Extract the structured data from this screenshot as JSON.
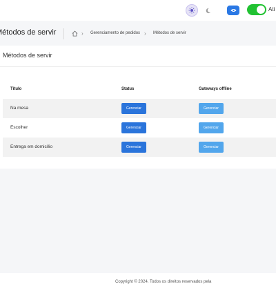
{
  "topbar": {
    "toggle_label": "Ati",
    "colors": {
      "toggle": "#21c232",
      "eye": "#2a78e4",
      "theme_active": "#e6e3f6"
    },
    "icons": [
      "sun-icon",
      "moon-icon",
      "eye-icon"
    ]
  },
  "header": {
    "title": "Métodos de servir",
    "breadcrumb": [
      "Gerenciamento de pedidos",
      "Métodos de servir"
    ]
  },
  "card": {
    "title": "Métodos de servir",
    "columns": [
      "Título",
      "Status",
      "Gateways offline"
    ],
    "rows": [
      {
        "label": "Na mesa",
        "status_button": "Gerenciar",
        "gateway_button": "Gerenciar"
      },
      {
        "label": "Escolher",
        "status_button": "Gerenciar",
        "gateway_button": "Gerenciar"
      },
      {
        "label": "Entrega em domicílio",
        "status_button": "Gerenciar",
        "gateway_button": "Gerenciar"
      }
    ],
    "colors": {
      "primary_button": "#2a74db",
      "secondary_button": "#52a6ec"
    }
  },
  "footer": {
    "text": "Copyright © 2024. Todos os direitos reservados pela"
  }
}
